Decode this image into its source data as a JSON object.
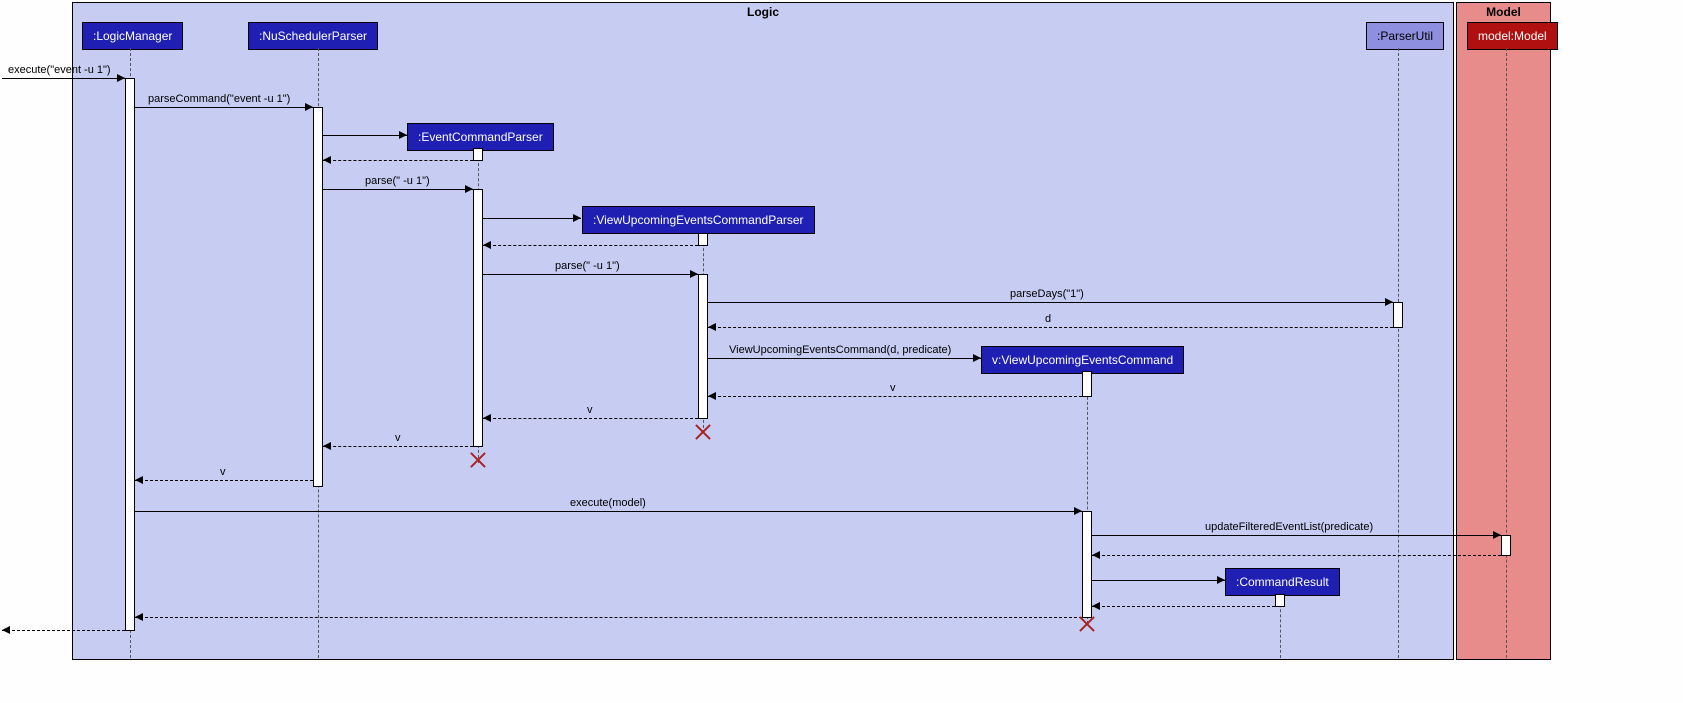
{
  "frames": {
    "logic": "Logic",
    "model": "Model"
  },
  "participants": {
    "logicManager": ":LogicManager",
    "nuSchedulerParser": ":NuSchedulerParser",
    "eventCommandParser": ":EventCommandParser",
    "viewUpcomingEventsCommandParser": ":ViewUpcomingEventsCommandParser",
    "viewUpcomingEventsCommand": "v:ViewUpcomingEventsCommand",
    "commandResult": ":CommandResult",
    "parserUtil": ":ParserUtil",
    "model": "model:Model"
  },
  "messages": {
    "executeEvent": "execute(\"event -u 1\")",
    "parseCommand": "parseCommand(\"event -u 1\")",
    "parse1": "parse(\" -u 1\")",
    "parse2": "parse(\" -u 1\")",
    "parseDays": "parseDays(\"1\")",
    "d": "d",
    "viewUpcomingCommand": "ViewUpcomingEventsCommand(d, predicate)",
    "v": "v",
    "executeModel": "execute(model)",
    "updateFilteredEventList": "updateFilteredEventList(predicate)"
  },
  "chart_data": {
    "type": "sequence_diagram",
    "frames": [
      {
        "name": "Logic",
        "contains": [
          "LogicManager",
          "NuSchedulerParser",
          "EventCommandParser",
          "ViewUpcomingEventsCommandParser",
          "ViewUpcomingEventsCommand",
          "CommandResult",
          "ParserUtil"
        ]
      },
      {
        "name": "Model",
        "contains": [
          "model:Model"
        ]
      }
    ],
    "participants": [
      {
        "id": "external",
        "name": "",
        "type": "actor"
      },
      {
        "id": "lm",
        "name": ":LogicManager"
      },
      {
        "id": "nsp",
        "name": ":NuSchedulerParser"
      },
      {
        "id": "ecp",
        "name": ":EventCommandParser",
        "created": true,
        "destroyed": true
      },
      {
        "id": "vuecp",
        "name": ":ViewUpcomingEventsCommandParser",
        "created": true,
        "destroyed": true
      },
      {
        "id": "vuec",
        "name": "v:ViewUpcomingEventsCommand",
        "created": true,
        "destroyed": true
      },
      {
        "id": "cr",
        "name": ":CommandResult",
        "created": true
      },
      {
        "id": "pu",
        "name": ":ParserUtil"
      },
      {
        "id": "model",
        "name": "model:Model"
      }
    ],
    "messages": [
      {
        "from": "external",
        "to": "lm",
        "label": "execute(\"event -u 1\")",
        "type": "sync"
      },
      {
        "from": "lm",
        "to": "nsp",
        "label": "parseCommand(\"event -u 1\")",
        "type": "sync"
      },
      {
        "from": "nsp",
        "to": "ecp",
        "label": "",
        "type": "create"
      },
      {
        "from": "ecp",
        "to": "nsp",
        "label": "",
        "type": "return"
      },
      {
        "from": "nsp",
        "to": "ecp",
        "label": "parse(\" -u 1\")",
        "type": "sync"
      },
      {
        "from": "ecp",
        "to": "vuecp",
        "label": "",
        "type": "create"
      },
      {
        "from": "vuecp",
        "to": "ecp",
        "label": "",
        "type": "return"
      },
      {
        "from": "ecp",
        "to": "vuecp",
        "label": "parse(\" -u 1\")",
        "type": "sync"
      },
      {
        "from": "vuecp",
        "to": "pu",
        "label": "parseDays(\"1\")",
        "type": "sync"
      },
      {
        "from": "pu",
        "to": "vuecp",
        "label": "d",
        "type": "return"
      },
      {
        "from": "vuecp",
        "to": "vuec",
        "label": "ViewUpcomingEventsCommand(d, predicate)",
        "type": "create"
      },
      {
        "from": "vuec",
        "to": "vuecp",
        "label": "v",
        "type": "return"
      },
      {
        "from": "vuecp",
        "to": "ecp",
        "label": "v",
        "type": "return"
      },
      {
        "from": "ecp",
        "to": "nsp",
        "label": "v",
        "type": "return"
      },
      {
        "from": "nsp",
        "to": "lm",
        "label": "v",
        "type": "return"
      },
      {
        "from": "lm",
        "to": "vuec",
        "label": "execute(model)",
        "type": "sync"
      },
      {
        "from": "vuec",
        "to": "model",
        "label": "updateFilteredEventList(predicate)",
        "type": "sync"
      },
      {
        "from": "model",
        "to": "vuec",
        "label": "",
        "type": "return"
      },
      {
        "from": "vuec",
        "to": "cr",
        "label": "",
        "type": "create"
      },
      {
        "from": "cr",
        "to": "vuec",
        "label": "",
        "type": "return"
      },
      {
        "from": "vuec",
        "to": "lm",
        "label": "",
        "type": "return"
      },
      {
        "from": "lm",
        "to": "external",
        "label": "",
        "type": "return"
      }
    ]
  }
}
